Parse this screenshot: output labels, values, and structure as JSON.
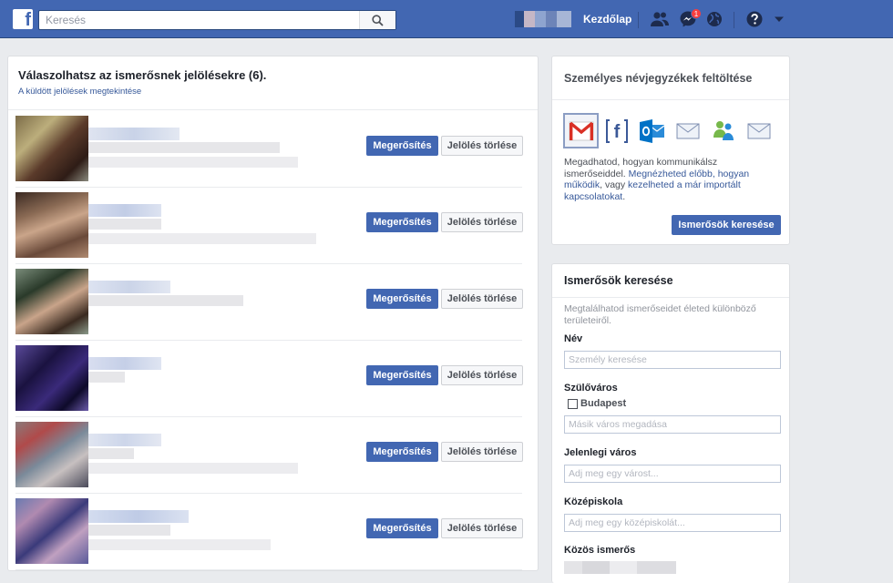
{
  "topbar": {
    "logo": "f",
    "search_placeholder": "Keresés",
    "home_label": "Kezdőlap",
    "messages_badge": "1",
    "icons": [
      "friends-icon",
      "messenger-icon",
      "globe-icon",
      "help-icon",
      "caret-down-icon",
      "search-icon"
    ]
  },
  "requests": {
    "title": "Válaszolhatsz az ismerősnek jelölésekre (6).",
    "sent_link": "A küldött jelölések megtekintése",
    "confirm_label": "Megerősítés",
    "delete_label": "Jelölés törlése",
    "count": 6
  },
  "contacts_card": {
    "title": "Személyes névjegyzékek feltöltése",
    "providers": [
      "gmail-icon",
      "facebook-icon",
      "outlook-icon",
      "mail-icon",
      "windows-live-icon",
      "mail-icon"
    ],
    "text_plain_1": "Megadhatod, hogyan kommunikálsz ismerőseiddel. ",
    "text_link_1": "Megnézheted előbb, hogyan működik",
    "text_plain_2": ", vagy ",
    "text_link_2": "kezelheted a már importált kapcsolatokat",
    "text_plain_3": ".",
    "button_label": "Ismerősök keresése"
  },
  "search_card": {
    "title": "Ismerősök keresése",
    "description": "Megtalálhatod ismerőseidet életed különböző területeiről.",
    "name_label": "Név",
    "name_placeholder": "Személy keresése",
    "hometown_label": "Szülőváros",
    "hometown_option": "Budapest",
    "hometown_placeholder": "Másik város megadása",
    "current_city_label": "Jelenlegi város",
    "current_city_placeholder": "Adj meg egy várost...",
    "highschool_label": "Középiskola",
    "highschool_placeholder": "Adj meg egy középiskolát...",
    "mutual_label": "Közös ismerős"
  },
  "colors": {
    "brand": "#4267b2",
    "link": "#365899",
    "background": "#e9ebee"
  }
}
